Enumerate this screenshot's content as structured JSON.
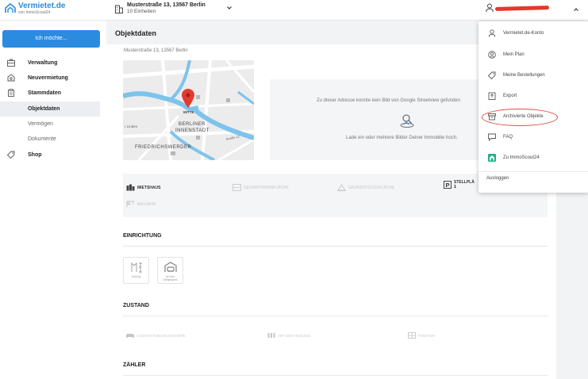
{
  "brand": {
    "name": "Vermietet.de",
    "sub": "von ImmoScout24",
    "color": "#2b8bd8"
  },
  "property": {
    "address": "Musterstraße 13, 13567 Berlin",
    "units": "10 Einheiten"
  },
  "sidebar": {
    "cta_label": "Ich möchte...",
    "items": [
      {
        "label": "Verwaltung",
        "icon": "briefcase-icon"
      },
      {
        "label": "Neuvermietung",
        "icon": "key-icon"
      },
      {
        "label": "Stammdaten",
        "icon": "clipboard-icon"
      },
      {
        "label": "Objektdaten"
      },
      {
        "label": "Vermögen"
      },
      {
        "label": "Dokumente"
      },
      {
        "label": "Shop",
        "icon": "tag-icon"
      }
    ]
  },
  "main": {
    "page_title": "Objektdaten",
    "address": "Musterstraße 13, 13567 Berlin",
    "map_labels": {
      "mitte": "MITTE",
      "berliner_line1": "BERLINER",
      "berliner_line2": "INNENSTADT",
      "friedrichswerder": "FRIEDRICHSWERDER",
      "linden": "r Linden",
      "street": "Straße 12"
    },
    "streetview_missing": "Zu dieser Adresse konnte kein Bild von Google Streetview gefunden",
    "upload_hint": "Lade ein oder mehrere Bilder Deiner Immobilie hoch.",
    "facts": {
      "mietshaus": "MIETSHAUS",
      "gesamtwohnflaeche": "GESAMTWOHNFLÄCHE",
      "grundstuecksflaeche": "GRUNDSTÜCKSFLÄCHE",
      "stellplaetze_label": "STELLPLÄ",
      "stellplaetze_value": "1",
      "baujahr": "BAUJAHR"
    },
    "sections": {
      "einrichtung": "EINRICHTUNG",
      "zustand": "ZUSTAND",
      "zaehler": "ZÄHLER"
    },
    "einrichtung_tiles": [
      {
        "label_line1": "Aufzug",
        "label_line2": ""
      },
      {
        "label_line1": "Art des",
        "label_line2": "Stellplatzes"
      }
    ],
    "zustand_items": [
      {
        "label": "AUSSTATTUNGSKATEGORIE"
      },
      {
        "label": "ART DER HEIZUNG"
      },
      {
        "label": "FENSTER"
      }
    ]
  },
  "user_menu": {
    "items": [
      {
        "label": "Vermietet.de-Konto",
        "icon": "user-icon"
      },
      {
        "label": "Mein Plan",
        "icon": "plan-icon"
      },
      {
        "label": "Meine Bestellungen",
        "icon": "tag-icon"
      },
      {
        "label": "Export",
        "icon": "export-icon"
      },
      {
        "label": "Archivierte Objekte",
        "icon": "archive-icon"
      },
      {
        "label": "FAQ",
        "icon": "chat-icon"
      },
      {
        "label": "Zu ImmoScout24",
        "icon": "immoscout-icon"
      }
    ],
    "logout": "Ausloggen"
  },
  "colors": {
    "primary": "#2a8be0",
    "annotation": "#e2473a",
    "immoscout": "#1fb08a"
  }
}
